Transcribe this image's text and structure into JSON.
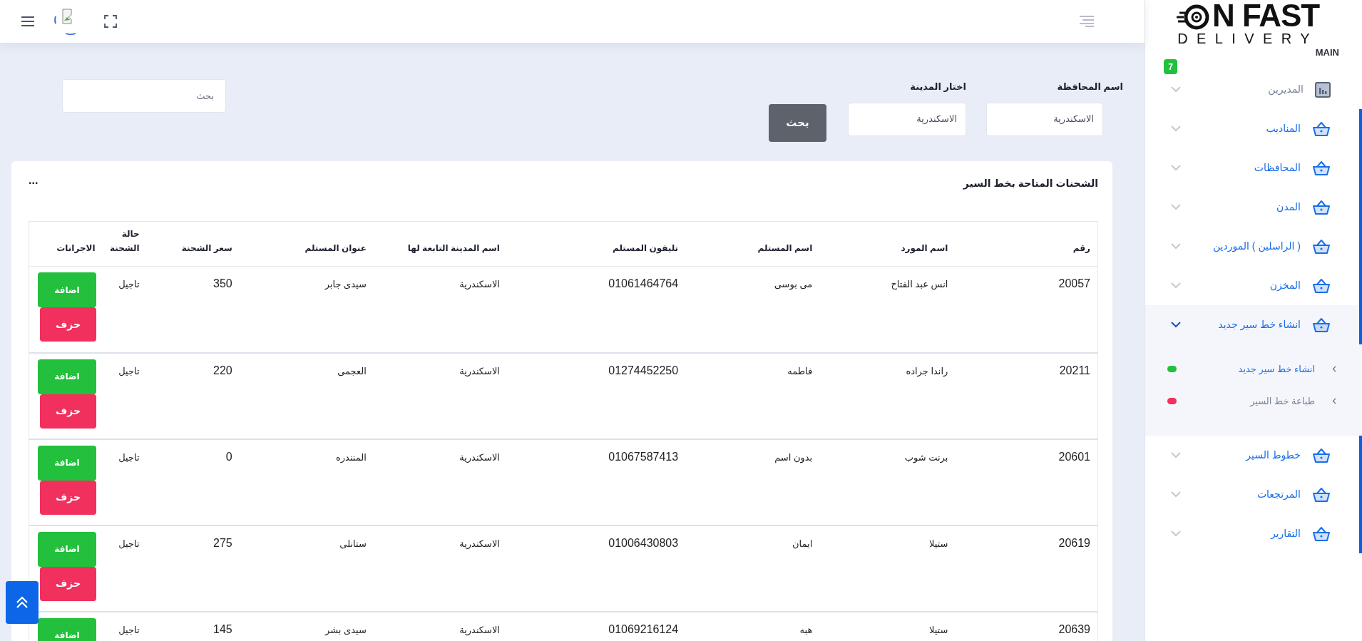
{
  "logo": {
    "title": "N FAST",
    "subtitle": "DELIVERY",
    "section": "MAIN"
  },
  "sidebar": {
    "badge": "7",
    "items": [
      {
        "label": "المديرين",
        "kind": "chart",
        "active": false,
        "expanded": false
      },
      {
        "label": "المناديب",
        "kind": "basket",
        "active": true,
        "expanded": false
      },
      {
        "label": "المحافظات",
        "kind": "basket",
        "active": true,
        "expanded": false
      },
      {
        "label": "المدن",
        "kind": "basket",
        "active": true,
        "expanded": false
      },
      {
        "label": "( الراسلين ) الموردين",
        "kind": "basket",
        "active": true,
        "expanded": false
      },
      {
        "label": "المخزن",
        "kind": "basket",
        "active": true,
        "expanded": false
      },
      {
        "label": "انشاء خط سير جديد",
        "kind": "basket",
        "active": true,
        "expanded": true,
        "children": [
          {
            "label": "انشاء خط سير جديد",
            "selected": true,
            "color": "#22c03c"
          },
          {
            "label": "طباعة خط السير",
            "selected": false,
            "color": "#f1305e"
          }
        ]
      },
      {
        "label": "خطوط السير",
        "kind": "basket",
        "active": true,
        "expanded": false
      },
      {
        "label": "المرتجعات",
        "kind": "basket",
        "active": true,
        "expanded": false
      },
      {
        "label": "التقارير",
        "kind": "basket",
        "active": true,
        "expanded": false
      }
    ]
  },
  "filters": {
    "governorate": {
      "label": "اسم المحافظة",
      "value": "الاسكندرية"
    },
    "city": {
      "label": "اختار المدينة",
      "value": "الاسكندرية"
    },
    "search_button": "بحث",
    "search": {
      "placeholder": "بحث"
    }
  },
  "card": {
    "title": "الشحنات المتاحة بخط السير",
    "menu": "...",
    "columns": [
      "رقم",
      "اسم المورد",
      "اسم المستلم",
      "تليفون المستلم",
      "اسم المدينة التابعة لها",
      "عنوان المستلم",
      "سعر الشحنة",
      "حالة الشحنة",
      "الاجرانات"
    ],
    "rows": [
      {
        "cells": [
          "20057",
          "انس عبد الفتاح",
          "مى بوسى",
          "01061464764",
          "الاسكندرية",
          "سيدى جابر",
          "350",
          "تاجيل"
        ],
        "actions": [
          "اضافة",
          "حزف"
        ]
      },
      {
        "cells": [
          "20211",
          "راندا جراده",
          "فاطمه",
          "01274452250",
          "الاسكندرية",
          "العجمى",
          "220",
          "تاجيل"
        ],
        "actions": [
          "اضافة",
          "حزف"
        ]
      },
      {
        "cells": [
          "20601",
          "برنت شوب",
          "بدون اسم",
          "01067587413",
          "الاسكندرية",
          "المنندره",
          "0",
          "تاجيل"
        ],
        "actions": [
          "اضافة",
          "حزف"
        ]
      },
      {
        "cells": [
          "20619",
          "ستيلا",
          "ايمان",
          "01006430803",
          "الاسكندرية",
          "ستانلى",
          "275",
          "تاجيل"
        ],
        "actions": [
          "اضافة",
          "حزف"
        ]
      },
      {
        "cells": [
          "20639",
          "ستيلا",
          "هبه",
          "01069216124",
          "الاسكندرية",
          "سيدى بشر",
          "145",
          "تاجيل"
        ],
        "actions": [
          "اضافة"
        ]
      }
    ]
  }
}
